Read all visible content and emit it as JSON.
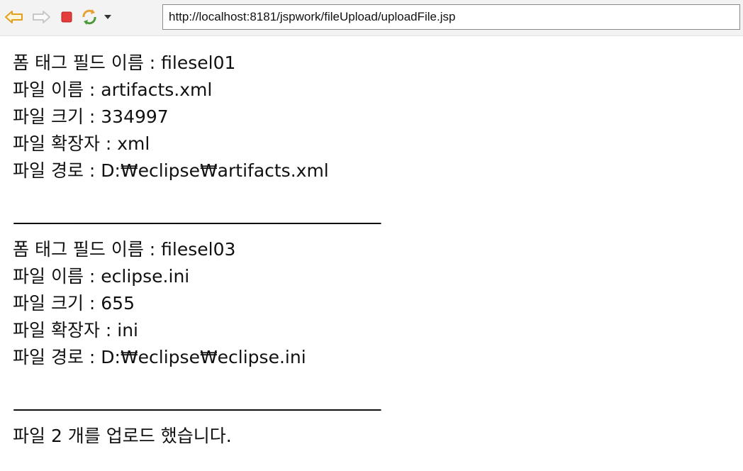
{
  "browser": {
    "url": "http://localhost:8181/jspwork/fileUpload/uploadFile.jsp",
    "icons": [
      "back-arrow-icon",
      "forward-arrow-icon",
      "stop-icon",
      "refresh-icon",
      "dropdown-arrow-icon"
    ]
  },
  "files": [
    {
      "field_line": "폼 태그 필드 이름 : filesel01",
      "name_line": "파일 이름 : artifacts.xml",
      "size_line": "파일 크기 : 334997",
      "ext_line": "파일 확장자 : xml",
      "path_line": "파일 경로 : D:₩eclipse₩artifacts.xml"
    },
    {
      "field_line": "폼 태그 필드 이름 : filesel03",
      "name_line": "파일 이름 : eclipse.ini",
      "size_line": "파일 크기 : 655",
      "ext_line": "파일 확장자 : ini",
      "path_line": "파일 경로 : D:₩eclipse₩eclipse.ini"
    }
  ],
  "separator": "--------------------------------------------------------------------------------------",
  "summary": "파일 2 개를 업로드 했습니다."
}
